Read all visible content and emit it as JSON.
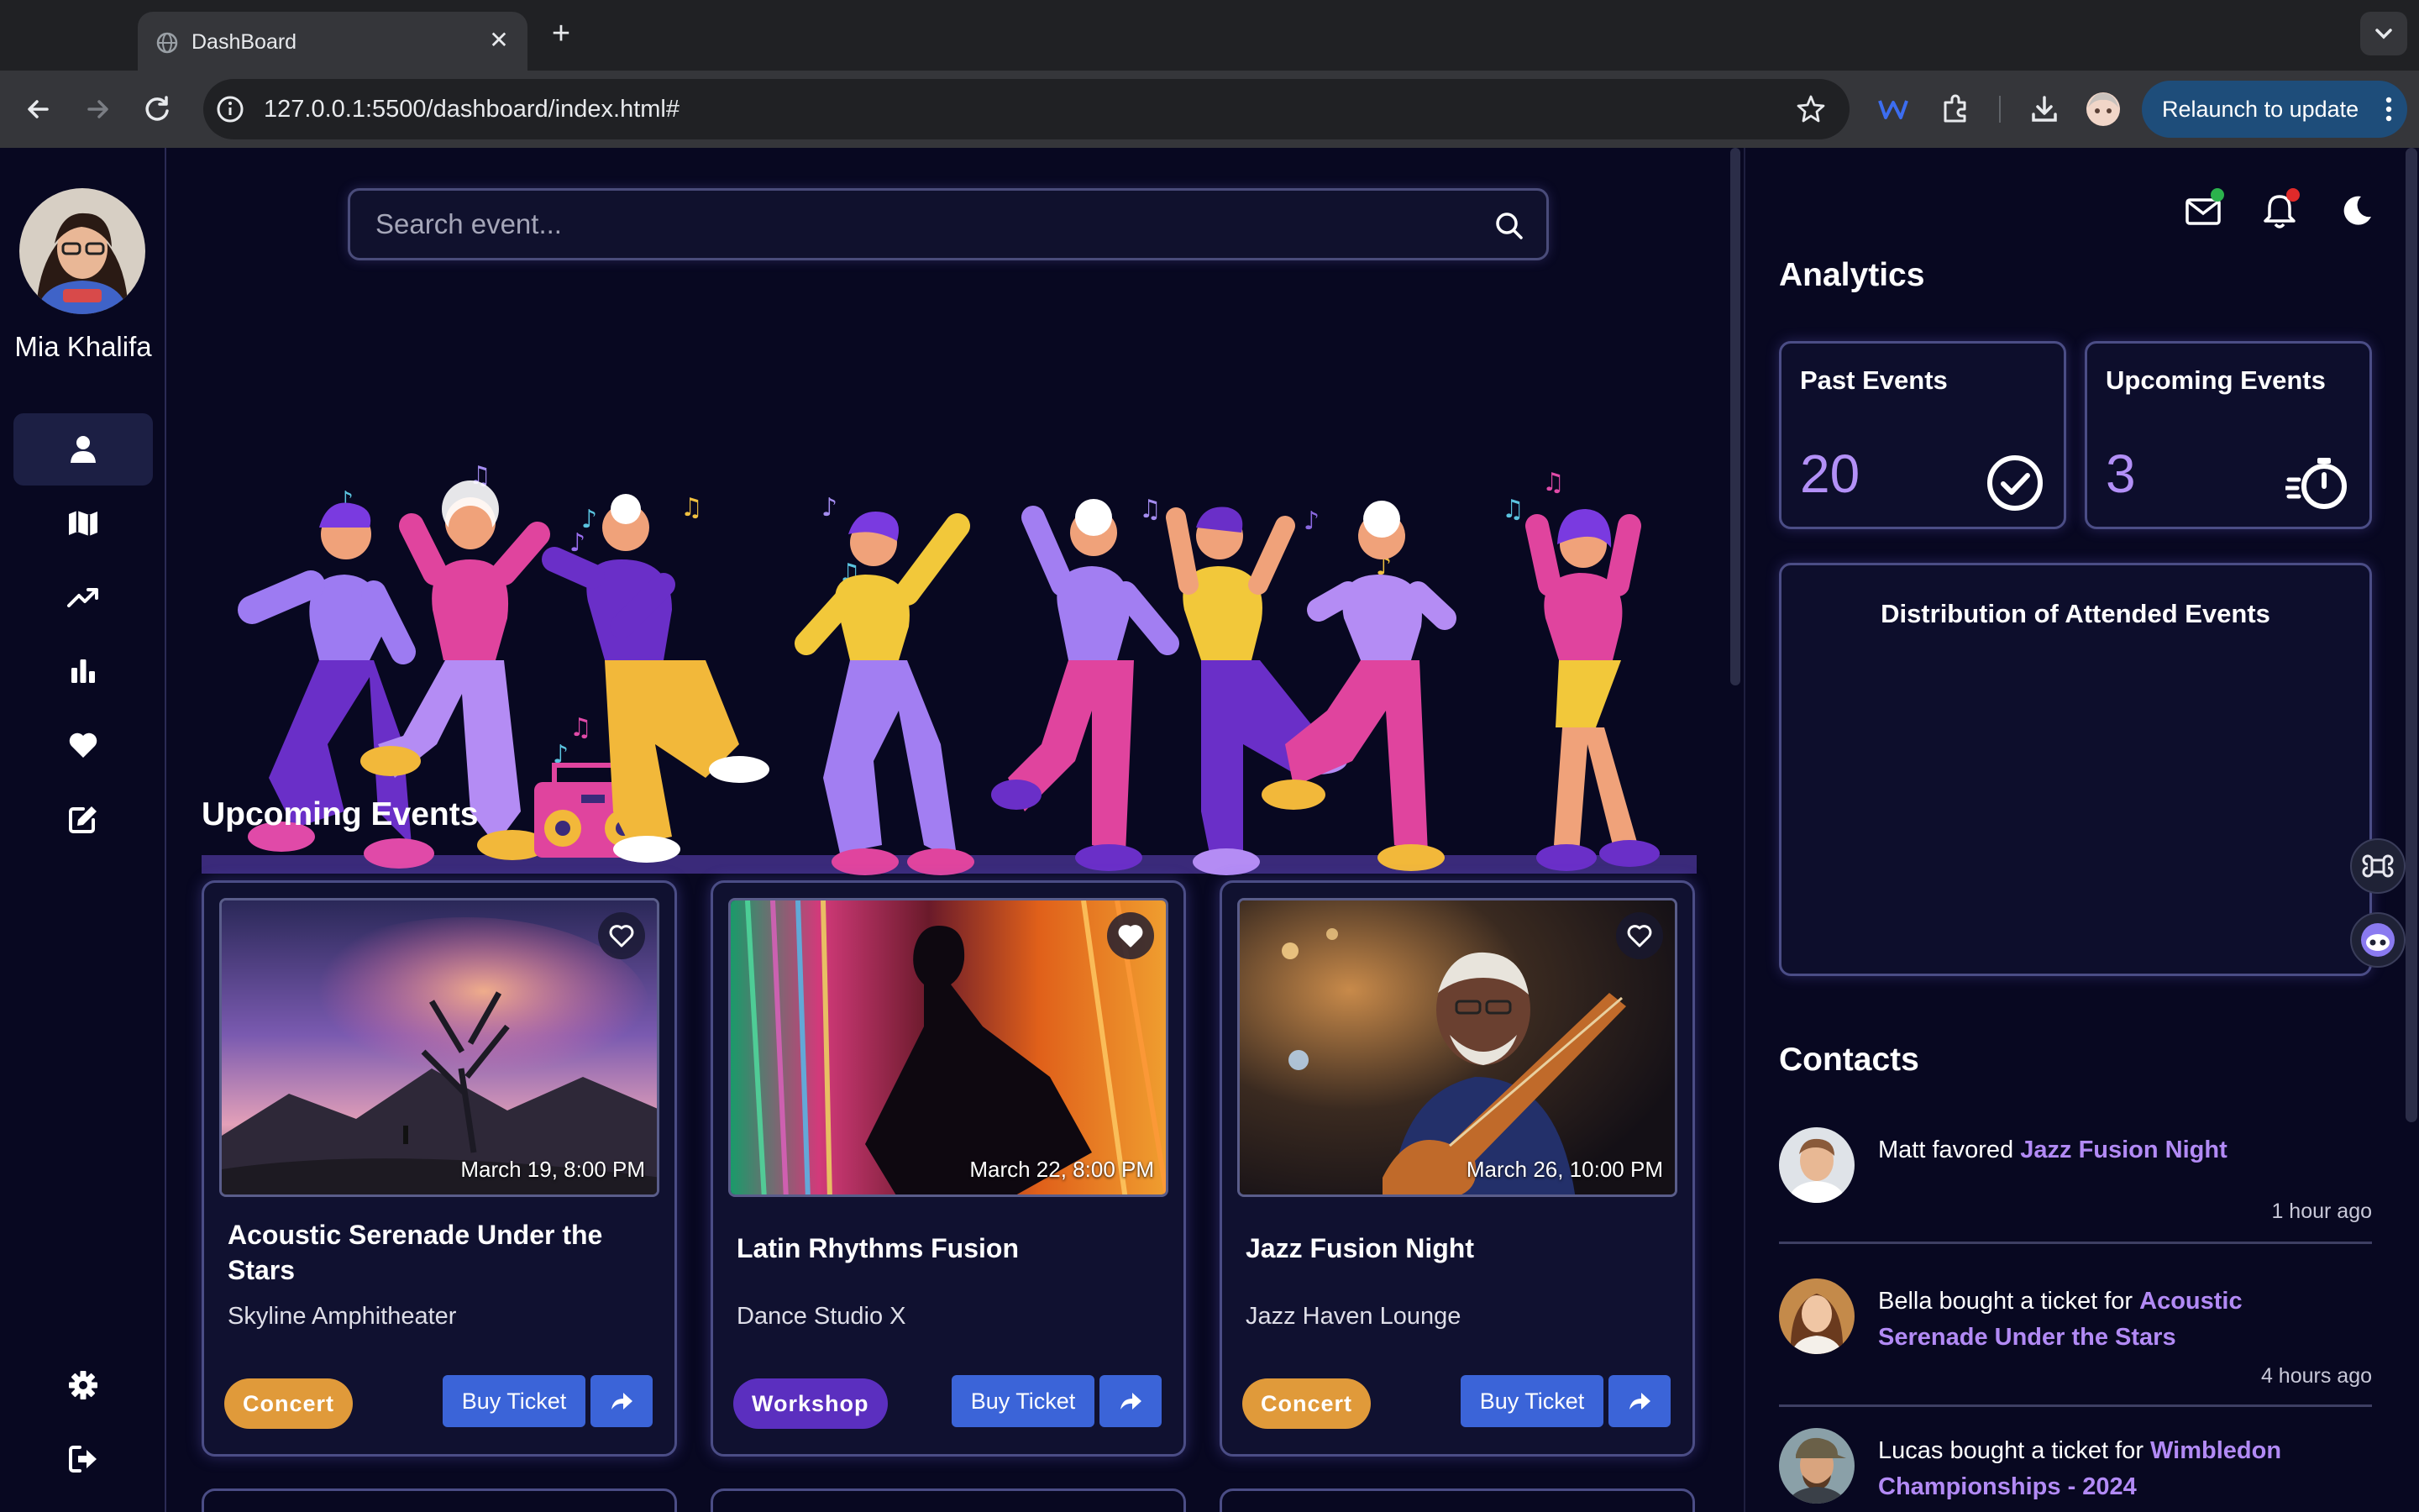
{
  "browser": {
    "tab_title": "DashBoard",
    "url": "127.0.0.1:5500/dashboard/index.html#",
    "relaunch_label": "Relaunch to update"
  },
  "user": {
    "name": "Mia Khalifa"
  },
  "sidebar": {
    "items": [
      {
        "icon": "user-icon",
        "active": true
      },
      {
        "icon": "map-icon"
      },
      {
        "icon": "trending-up-icon"
      },
      {
        "icon": "bar-chart-icon"
      },
      {
        "icon": "heart-icon"
      },
      {
        "icon": "edit-icon"
      }
    ],
    "bottom": [
      {
        "icon": "gear-icon"
      },
      {
        "icon": "logout-icon"
      }
    ]
  },
  "search": {
    "placeholder": "Search event..."
  },
  "upcoming": {
    "title": "Upcoming Events",
    "events": [
      {
        "date": "March 19, 8:00 PM",
        "title": "Acoustic Serenade Under the Stars",
        "venue": "Skyline Amphitheater",
        "category": "Concert",
        "category_color": "#e09a3a",
        "buy_label": "Buy Ticket",
        "favorited": false
      },
      {
        "date": "March 22, 8:00 PM",
        "title": "Latin Rhythms Fusion",
        "venue": "Dance Studio X",
        "category": "Workshop",
        "category_color": "#5b2fbf",
        "buy_label": "Buy Ticket",
        "favorited": true
      },
      {
        "date": "March 26, 10:00 PM",
        "title": "Jazz Fusion Night",
        "venue": "Jazz Haven Lounge",
        "category": "Concert",
        "category_color": "#e09a3a",
        "buy_label": "Buy Ticket",
        "favorited": false
      }
    ]
  },
  "analytics": {
    "title": "Analytics",
    "past": {
      "label": "Past Events",
      "value": "20"
    },
    "upcoming": {
      "label": "Upcoming Events",
      "value": "3"
    },
    "chart_title": "Distribution of Attended Events"
  },
  "contacts": {
    "title": "Contacts",
    "items": [
      {
        "text": "Matt favored ",
        "event": "Jazz Fusion Night",
        "time": "1 hour ago"
      },
      {
        "text": "Bella bought a ticket for ",
        "event": "Acoustic Serenade Under the Stars",
        "time": "4 hours ago"
      },
      {
        "text": "Lucas bought a ticket for ",
        "event": "Wimbledon Championships - 2024",
        "time": ""
      }
    ]
  },
  "colors": {
    "accent": "#b390f7",
    "button": "#3b64d8",
    "background": "#080821"
  }
}
